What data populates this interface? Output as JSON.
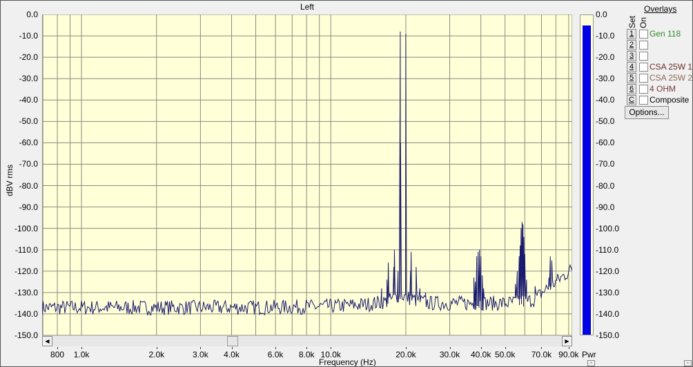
{
  "window": {
    "title": "Left"
  },
  "chart_data": {
    "type": "line",
    "title": "Left",
    "xlabel": "Frequency (Hz)",
    "ylabel": "dBV rms",
    "xscale": "log",
    "xlim": [
      695,
      93000
    ],
    "ylim": [
      -150,
      0
    ],
    "grid": true,
    "background": "#ffffd8",
    "line_color": "#1a1a6e",
    "x_ticks": [
      {
        "value": 800,
        "label": "800"
      },
      {
        "value": 1000,
        "label": "1.0k"
      },
      {
        "value": 2000,
        "label": "2.0k"
      },
      {
        "value": 3000,
        "label": "3.0k"
      },
      {
        "value": 4000,
        "label": "4.0k"
      },
      {
        "value": 6000,
        "label": "6.0k"
      },
      {
        "value": 8000,
        "label": "8.0k"
      },
      {
        "value": 10000,
        "label": "10.0k"
      },
      {
        "value": 20000,
        "label": "20.0k"
      },
      {
        "value": 30000,
        "label": "30.0k"
      },
      {
        "value": 40000,
        "label": "40.0k"
      },
      {
        "value": 50000,
        "label": "50.0k"
      },
      {
        "value": 70000,
        "label": "70.0k"
      },
      {
        "value": 90000,
        "label": "90.0k"
      }
    ],
    "y_ticks": [
      "0.0",
      "-10.0",
      "-20.0",
      "-30.0",
      "-40.0",
      "-50.0",
      "-60.0",
      "-70.0",
      "-80.0",
      "-90.0",
      "-100.0",
      "-110.0",
      "-120.0",
      "-130.0",
      "-140.0",
      "-150.0"
    ],
    "noise_floor": [
      [
        695,
        -137
      ],
      [
        5000,
        -137
      ],
      [
        10000,
        -136.5
      ],
      [
        14000,
        -135.5
      ],
      [
        17000,
        -134
      ],
      [
        19000,
        -131
      ],
      [
        21000,
        -133
      ],
      [
        25000,
        -135
      ],
      [
        35000,
        -135
      ],
      [
        50000,
        -135
      ],
      [
        62000,
        -134
      ],
      [
        66000,
        -133
      ],
      [
        72000,
        -129
      ],
      [
        80000,
        -125
      ],
      [
        93000,
        -119
      ]
    ],
    "peaks": [
      [
        16000,
        -128
      ],
      [
        16800,
        -124
      ],
      [
        17000,
        -116
      ],
      [
        17900,
        -118
      ],
      [
        18000,
        -110
      ],
      [
        18600,
        -120
      ],
      [
        19000,
        -8
      ],
      [
        19050,
        -60
      ],
      [
        20000,
        -9
      ],
      [
        20050,
        -62
      ],
      [
        20900,
        -120
      ],
      [
        21000,
        -111
      ],
      [
        22000,
        -118
      ],
      [
        22800,
        -128
      ],
      [
        24000,
        -130
      ],
      [
        37500,
        -123
      ],
      [
        38000,
        -125
      ],
      [
        38500,
        -113
      ],
      [
        39000,
        -111
      ],
      [
        39500,
        -110
      ],
      [
        40000,
        -113
      ],
      [
        40500,
        -122
      ],
      [
        41000,
        -128
      ],
      [
        55000,
        -126
      ],
      [
        56000,
        -120
      ],
      [
        57000,
        -113
      ],
      [
        57500,
        -108
      ],
      [
        58000,
        -100
      ],
      [
        58500,
        -97
      ],
      [
        59000,
        -98
      ],
      [
        59500,
        -104
      ],
      [
        60000,
        -112
      ],
      [
        61000,
        -124
      ],
      [
        66000,
        -127
      ],
      [
        75000,
        -123
      ],
      [
        76000,
        -113
      ],
      [
        77000,
        -115
      ]
    ]
  },
  "scrollbar": {
    "left_arrow": "◀",
    "right_arrow": "▶",
    "position_fraction": 0.35
  },
  "meter": {
    "label": "Pwr",
    "level_db": -5.5,
    "color": "#0000e6",
    "ticks": [
      "0.0",
      "-10.0",
      "-20.0",
      "-30.0",
      "-40.0",
      "-50.0",
      "-60.0",
      "-70.0",
      "-80.0",
      "-90.0",
      "-100.0",
      "-110.0",
      "-120.0",
      "-130.0",
      "-140.0",
      "-150.0"
    ]
  },
  "overlays": {
    "title": "Overlays",
    "set_header": "Set",
    "on_header": "On",
    "items": [
      {
        "set": "1",
        "label": "Gen 118",
        "color": "#2e8b2e",
        "checked": false
      },
      {
        "set": "2",
        "label": "",
        "color": "#000000",
        "checked": false
      },
      {
        "set": "3",
        "label": "",
        "color": "#000000",
        "checked": false
      },
      {
        "set": "4",
        "label": "CSA 25W 1",
        "color": "#6b2a2a",
        "checked": false
      },
      {
        "set": "5",
        "label": "CSA 25W 2",
        "color": "#8a6a50",
        "checked": false
      },
      {
        "set": "6",
        "label": "4 OHM",
        "color": "#7a3a3a",
        "checked": false
      },
      {
        "set": "C",
        "label": "Composite",
        "color": "#000000",
        "checked": false
      }
    ],
    "options_label": "Options..."
  },
  "minimize_buttons": [
    "-",
    "-"
  ]
}
